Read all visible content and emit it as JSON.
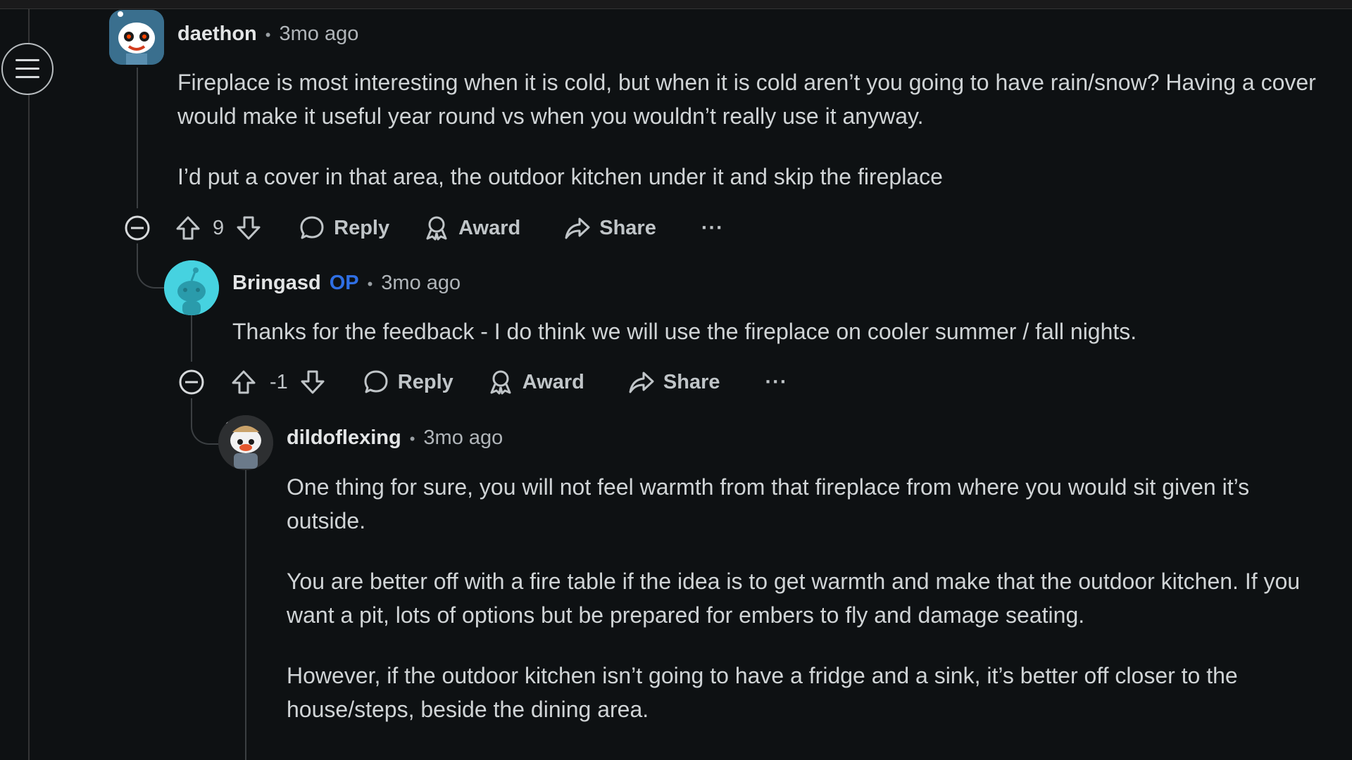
{
  "comments": [
    {
      "author": "daethon",
      "op_badge": "",
      "separator": "•",
      "time": "3mo ago",
      "paragraphs": [
        "Fireplace is most interesting when it is cold, but when it is cold aren’t you going to have rain/snow? Having a cover would make it useful year round vs when you wouldn’t really use it anyway.",
        "I’d put a cover in that area, the outdoor kitchen under it and skip the fireplace"
      ],
      "score": "9",
      "reply_label": "Reply",
      "award_label": "Award",
      "share_label": "Share",
      "more_label": "···"
    },
    {
      "author": "Bringasd",
      "op_badge": "OP",
      "separator": "•",
      "time": "3mo ago",
      "paragraphs": [
        "Thanks for the feedback - I do think we will use the fireplace on cooler summer / fall nights."
      ],
      "score": "-1",
      "reply_label": "Reply",
      "award_label": "Award",
      "share_label": "Share",
      "more_label": "···"
    },
    {
      "author": "dildoflexing",
      "op_badge": "",
      "separator": "•",
      "time": "3mo ago",
      "paragraphs": [
        "One thing for sure, you will not feel warmth from that fireplace from where you would sit given it’s outside.",
        "You are better off with a fire table if the idea is to get warmth and make that the outdoor kitchen. If you want a pit, lots of options but be prepared for embers to fly and damage seating.",
        "However, if the outdoor kitchen isn’t going to have a fridge and a sink, it’s better off closer to the house/steps, beside the dining area."
      ]
    }
  ],
  "colors": {
    "background": "#0e1113",
    "op_badge": "#2f6fe4",
    "avatar_cyan": "#36c5d4"
  }
}
